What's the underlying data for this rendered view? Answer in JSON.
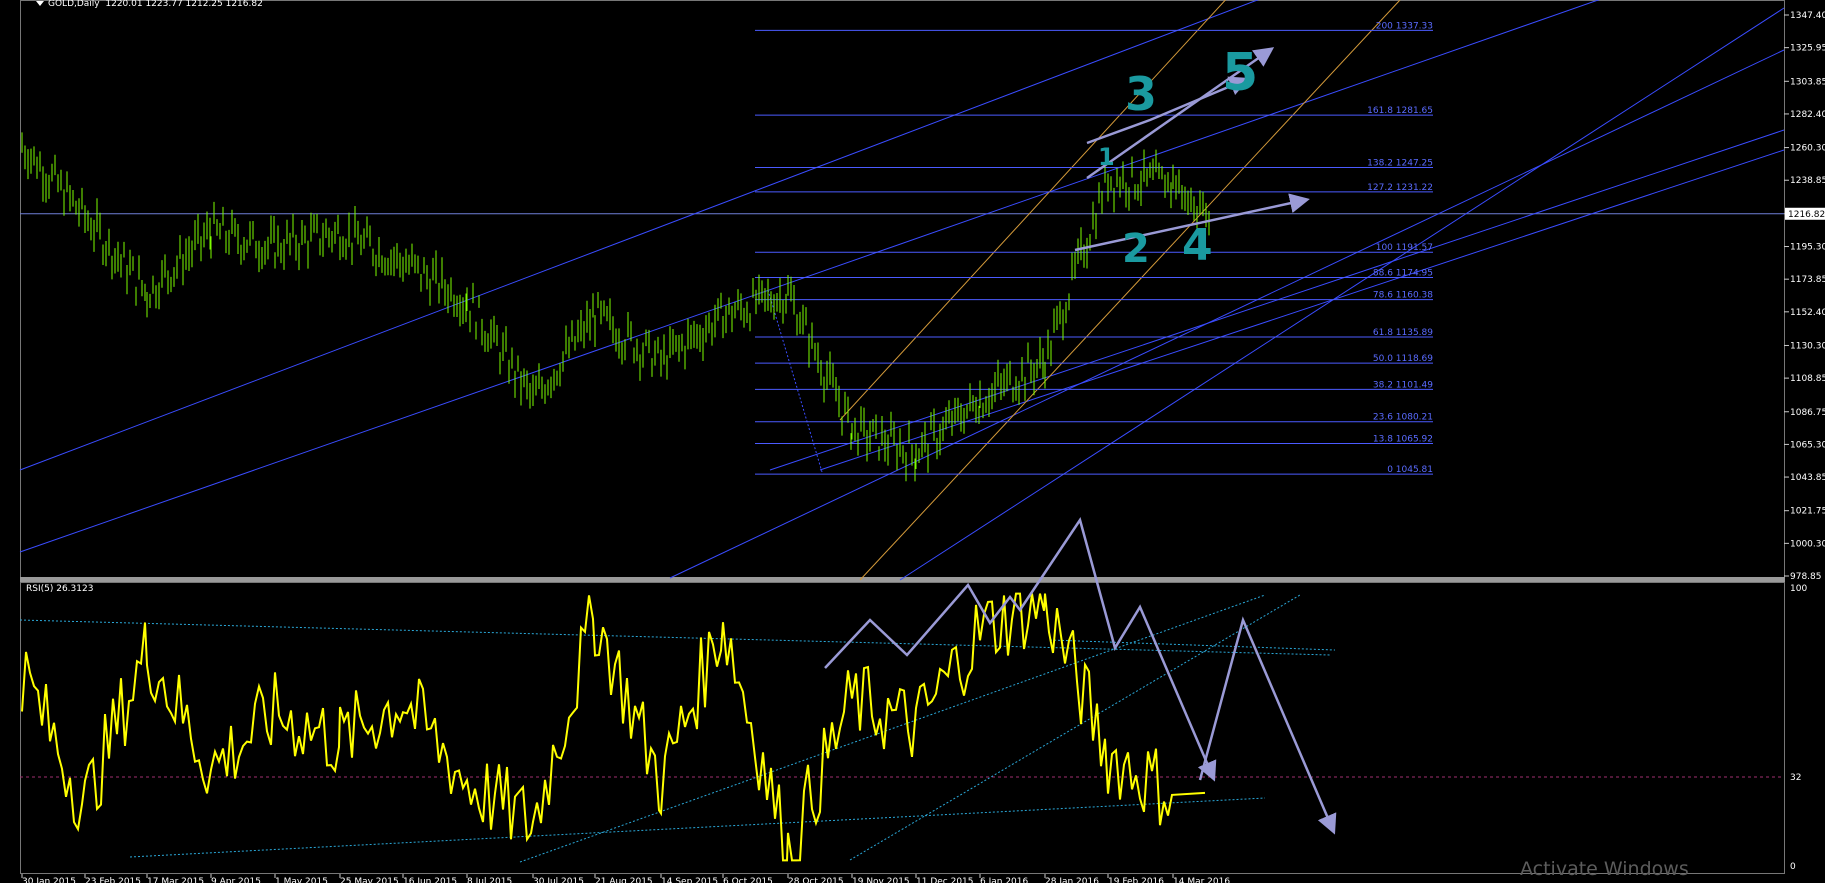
{
  "header": {
    "symbol": "GOLD,Daily",
    "ohlc": "1220.01 1223.77 1212.25 1216.82"
  },
  "rsi": {
    "label": "RSI(5) 26.3123",
    "level_label": "32",
    "top_label": "100",
    "bottom_label": "0"
  },
  "watermark": "Activate Windows",
  "colors": {
    "background": "#000000",
    "price_candles": "#7cfc00",
    "rsi_line": "#ffff00",
    "fib_lines": "#4b5bff",
    "channel_lines": "#3a4cff",
    "orange_channel": "#d49a3a",
    "arrows": "#9a9ad6",
    "wave_labels": "#1a9aa0"
  },
  "chart_data": [
    {
      "type": "line",
      "title": "GOLD,Daily",
      "series": [
        {
          "name": "GOLD,Daily",
          "x": [
            "30 Jan 2015",
            "23 Feb 2015",
            "17 Mar 2015",
            "9 Apr 2015",
            "1 May 2015",
            "25 May 2015",
            "16 Jun 2015",
            "8 Jul 2015",
            "30 Jul 2015",
            "21 Aug 2015",
            "14 Sep 2015",
            "6 Oct 2015",
            "28 Oct 2015",
            "19 Nov 2015",
            "11 Dec 2015",
            "6 Jan 2016",
            "28 Jan 2016",
            "19 Feb 2016",
            "14 Mar 2016"
          ],
          "values": [
            1262,
            1215,
            1165,
            1205,
            1195,
            1205,
            1185,
            1160,
            1095,
            1150,
            1120,
            1150,
            1165,
            1075,
            1060,
            1095,
            1120,
            1240,
            1237
          ]
        }
      ],
      "current_price": "1216.82",
      "y_ticks": [
        "1347.40",
        "1325.95",
        "1303.85",
        "1282.40",
        "1260.30",
        "1238.85",
        "1216.82",
        "1195.30",
        "1173.85",
        "1152.40",
        "1130.30",
        "1108.85",
        "1086.75",
        "1065.30",
        "1043.85",
        "1021.75",
        "1000.30",
        "978.85"
      ],
      "x_ticks": [
        "30 Jan 2015",
        "23 Feb 2015",
        "17 Mar 2015",
        "9 Apr 2015",
        "1 May 2015",
        "25 May 2015",
        "16 Jun 2015",
        "8 Jul 2015",
        "30 Jul 2015",
        "21 Aug 2015",
        "14 Sep 2015",
        "6 Oct 2015",
        "28 Oct 2015",
        "19 Nov 2015",
        "11 Dec 2015",
        "6 Jan 2016",
        "28 Jan 2016",
        "19 Feb 2016",
        "14 Mar 2016"
      ],
      "fib_levels": [
        {
          "label": "200 1337.33",
          "value": 1337.33
        },
        {
          "label": "161.8 1281.65",
          "value": 1281.65
        },
        {
          "label": "138.2 1247.25",
          "value": 1247.25
        },
        {
          "label": "127.2 1231.22",
          "value": 1231.22
        },
        {
          "label": "100 1191.57",
          "value": 1191.57
        },
        {
          "label": "88.6 1174.95",
          "value": 1174.95
        },
        {
          "label": "78.6 1160.38",
          "value": 1160.38
        },
        {
          "label": "61.8 1135.89",
          "value": 1135.89
        },
        {
          "label": "50.0 1118.69",
          "value": 1118.69
        },
        {
          "label": "38.2 1101.49",
          "value": 1101.49
        },
        {
          "label": "23.6 1080.21",
          "value": 1080.21
        },
        {
          "label": "13.8 1065.92",
          "value": 1065.92
        },
        {
          "label": "0 1045.81",
          "value": 1045.81
        }
      ],
      "wave_labels": [
        "1",
        "2",
        "3",
        "4",
        "5"
      ]
    },
    {
      "type": "line",
      "title": "RSI(5) 26.3123",
      "ylim": [
        0,
        100
      ],
      "y_ticks": [
        "100",
        "32",
        "0"
      ],
      "series": [
        {
          "name": "RSI(5)",
          "values": [
            70,
            22,
            78,
            35,
            55,
            45,
            60,
            30,
            15,
            90,
            30,
            88,
            5,
            60,
            50,
            85,
            95,
            40,
            26
          ]
        }
      ]
    }
  ]
}
